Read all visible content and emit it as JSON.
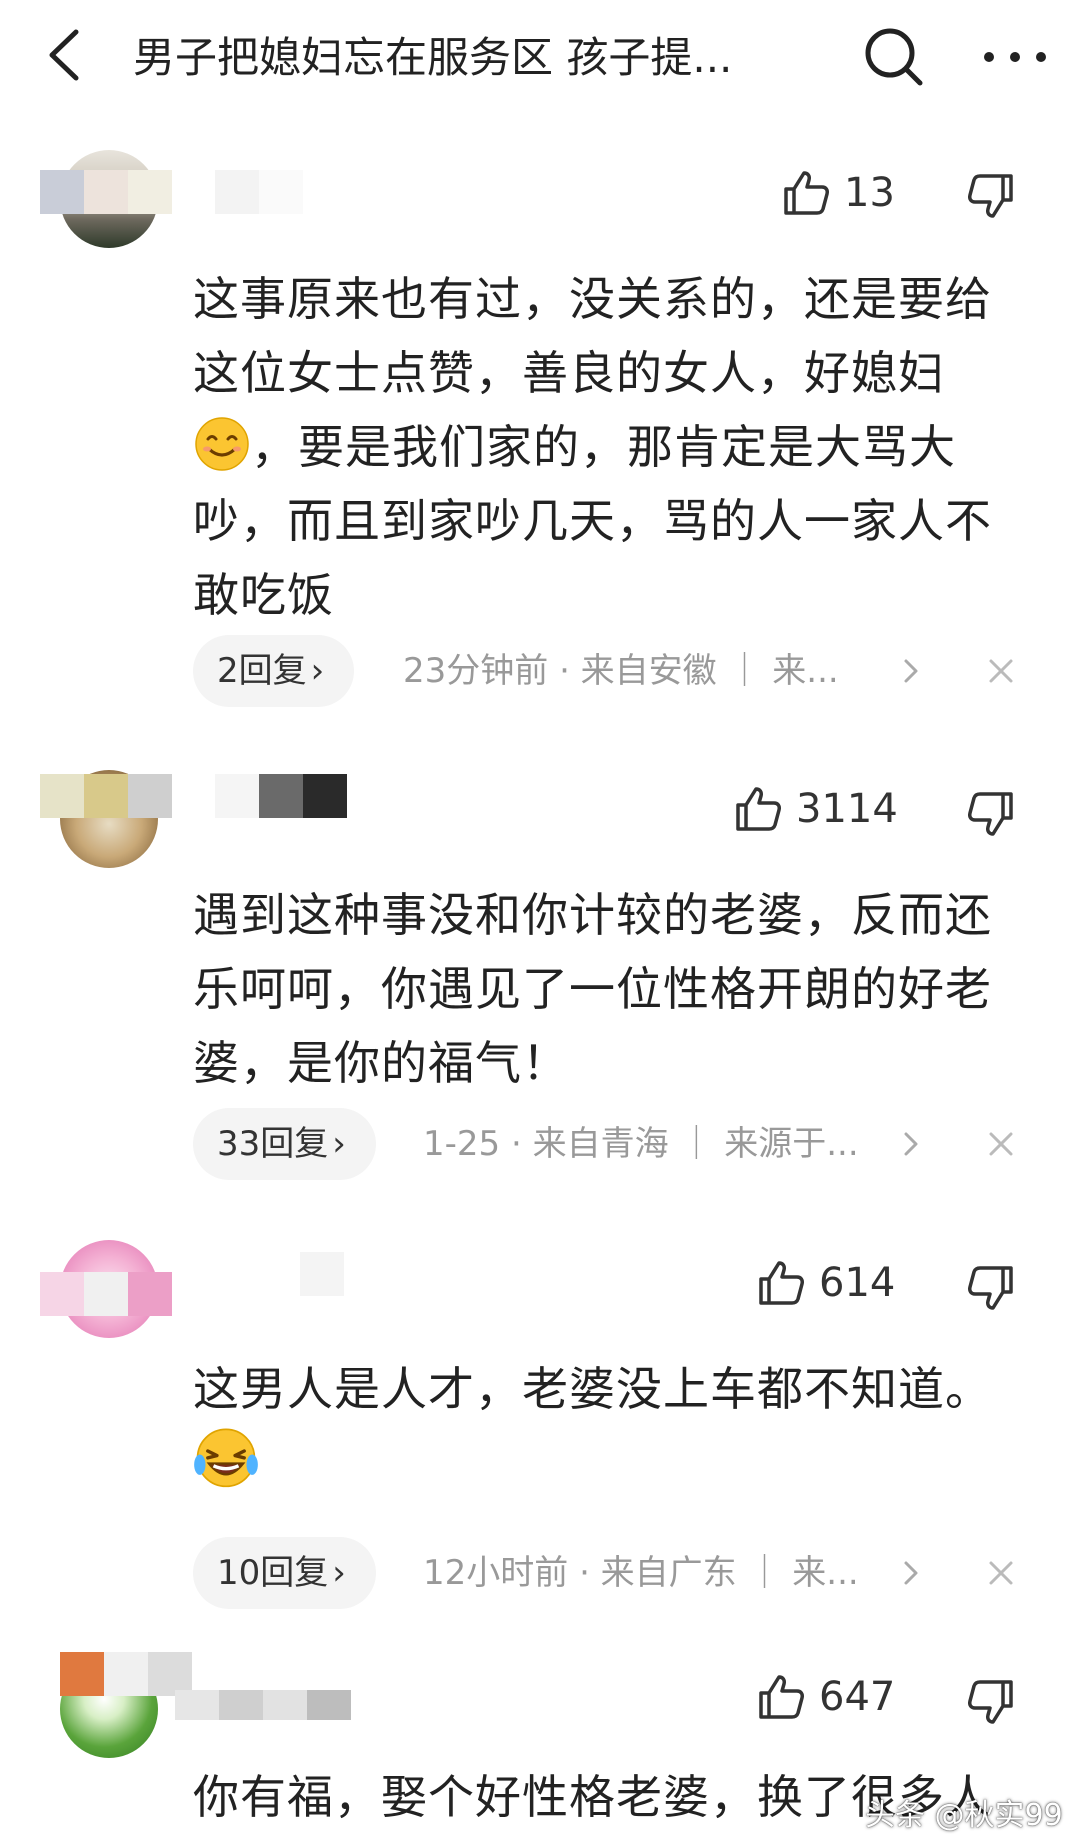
{
  "header": {
    "title": "男子把媳妇忘在服务区 孩子提..."
  },
  "comments": [
    {
      "likes": "13",
      "text_lines": [
        "这事原来也有过，没关系的，还是要给",
        "这位女士点赞，善良的女人，好媳妇"
      ],
      "text_after_emoji": "，要是我们家的，那肯定是大骂大",
      "text_lines_2": [
        "吵，而且到家吵几天，骂的人一家人不",
        "敢吃饭"
      ],
      "reply_label": "2回复",
      "meta": "23分钟前 · 来自安徽 ｜ 来..."
    },
    {
      "likes": "3114",
      "text_lines": [
        "遇到这种事没和你计较的老婆，反而还",
        "乐呵呵，你遇见了一位性格开朗的好老",
        "婆，是你的福气！"
      ],
      "reply_label": "33回复",
      "meta": "1-25 · 来自青海 ｜ 来源于..."
    },
    {
      "likes": "614",
      "text_lines": [
        "这男人是人才，老婆没上车都不知道。"
      ],
      "reply_label": "10回复",
      "meta": "12小时前 · 来自广东 ｜ 来..."
    },
    {
      "likes": "647",
      "text_lines": [
        "你有福，娶个好性格老婆，换了很多人"
      ]
    }
  ],
  "watermark": "头条 @秋实99",
  "icons": {
    "back": "chevron-left-icon",
    "search": "search-icon",
    "more": "more-dots-icon",
    "like": "thumbs-up-icon",
    "dislike": "thumbs-down-icon",
    "close": "close-icon",
    "smile_emoji": "smile-emoji",
    "laugh_emoji": "laugh-cry-emoji"
  }
}
